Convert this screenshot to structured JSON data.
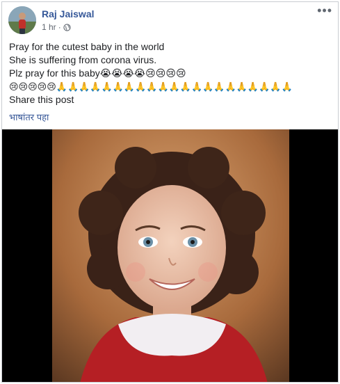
{
  "post": {
    "author": "Raj Jaiswal",
    "time": "1 hr",
    "separator": "·",
    "more_label": "•••",
    "lines": [
      "Pray for the cutest baby in the world",
      "She is suffering from corona virus.",
      "Plz pray for this baby😭😭😭😭😢😢😢😢",
      "😢😢😢😢😢🙏🙏🙏🙏🙏🙏🙏🙏🙏🙏🙏🙏🙏🙏🙏🙏🙏🙏🙏🙏🙏",
      "Share this post"
    ],
    "translate_label": "भाषांतर पहा"
  },
  "colors": {
    "author": "#365899",
    "link": "#385898",
    "meta": "#606770"
  }
}
